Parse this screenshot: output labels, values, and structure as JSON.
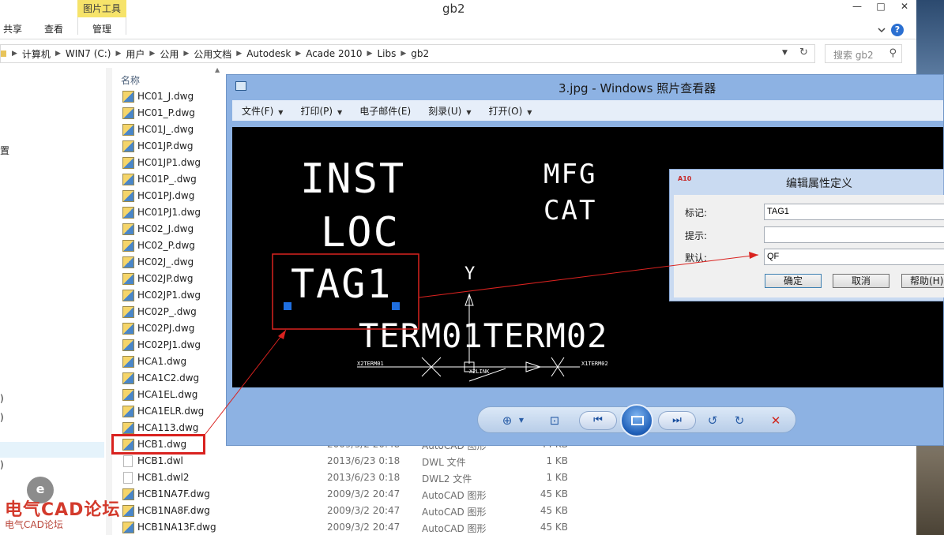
{
  "explorer": {
    "title": "gb2",
    "context_tab": "图片工具",
    "tabs": [
      "共享",
      "查看",
      "管理"
    ],
    "controls": {
      "minimize": "—",
      "maximize": "□",
      "close": "✕"
    },
    "help": "?",
    "address": [
      "计算机",
      "WIN7 (C:)",
      "用户",
      "公用",
      "公用文档",
      "Autodesk",
      "Acade 2010",
      "Libs",
      "gb2"
    ],
    "search_placeholder": "搜索 gb2",
    "nav_fragments": [
      "置",
      ")",
      ")",
      ")"
    ],
    "column_header": "名称",
    "files": [
      {
        "name": "HC01_J.dwg",
        "icon": "dwg-icon"
      },
      {
        "name": "HC01_P.dwg",
        "icon": "dwg-icon"
      },
      {
        "name": "HC01J_.dwg",
        "icon": "dwg-icon"
      },
      {
        "name": "HC01JP.dwg",
        "icon": "dwg-icon"
      },
      {
        "name": "HC01JP1.dwg",
        "icon": "dwg-icon"
      },
      {
        "name": "HC01P_.dwg",
        "icon": "dwg-icon"
      },
      {
        "name": "HC01PJ.dwg",
        "icon": "dwg-icon"
      },
      {
        "name": "HC01PJ1.dwg",
        "icon": "dwg-icon"
      },
      {
        "name": "HC02_J.dwg",
        "icon": "dwg-icon"
      },
      {
        "name": "HC02_P.dwg",
        "icon": "dwg-icon"
      },
      {
        "name": "HC02J_.dwg",
        "icon": "dwg-icon"
      },
      {
        "name": "HC02JP.dwg",
        "icon": "dwg-icon"
      },
      {
        "name": "HC02JP1.dwg",
        "icon": "dwg-icon"
      },
      {
        "name": "HC02P_.dwg",
        "icon": "dwg-icon"
      },
      {
        "name": "HC02PJ.dwg",
        "icon": "dwg-icon"
      },
      {
        "name": "HC02PJ1.dwg",
        "icon": "dwg-icon"
      },
      {
        "name": "HCA1.dwg",
        "icon": "dwg-icon"
      },
      {
        "name": "HCA1C2.dwg",
        "icon": "dwg-icon"
      },
      {
        "name": "HCA1EL.dwg",
        "icon": "dwg-icon"
      },
      {
        "name": "HCA1ELR.dwg",
        "icon": "dwg-icon"
      },
      {
        "name": "HCA113.dwg",
        "icon": "dwg-icon"
      },
      {
        "name": "HCB1.dwg",
        "date": "2009/3/2 20:48",
        "type": "AutoCAD 图形",
        "size": "44 KB",
        "icon": "dwg-icon"
      },
      {
        "name": "HCB1.dwl",
        "date": "2013/6/23 0:18",
        "type": "DWL 文件",
        "size": "1 KB",
        "icon": "file-icon"
      },
      {
        "name": "HCB1.dwl2",
        "date": "2013/6/23 0:18",
        "type": "DWL2 文件",
        "size": "1 KB",
        "icon": "file-icon"
      },
      {
        "name": "HCB1NA7F.dwg",
        "date": "2009/3/2 20:47",
        "type": "AutoCAD 图形",
        "size": "45 KB",
        "icon": "dwg-icon"
      },
      {
        "name": "HCB1NA8F.dwg",
        "date": "2009/3/2 20:47",
        "type": "AutoCAD 图形",
        "size": "45 KB",
        "icon": "dwg-icon"
      },
      {
        "name": "HCB1NA13F.dwg",
        "date": "2009/3/2 20:47",
        "type": "AutoCAD 图形",
        "size": "45 KB",
        "icon": "dwg-icon"
      }
    ]
  },
  "viewer": {
    "title": "3.jpg - Windows 照片查看器",
    "menus": [
      "文件(F)",
      "打印(P)",
      "电子邮件(E)",
      "刻录(U)",
      "打开(O)"
    ],
    "menus_with_dropdown": [
      true,
      true,
      false,
      true,
      true
    ],
    "cad": {
      "inst": "INST",
      "loc": "LOC",
      "mfg": "MFG",
      "cat": "CAT",
      "tag": "TAG1",
      "y": "Y",
      "term": "TERM01TERM02",
      "x2term01": "X2TERM01",
      "x1term02": "X1TERM02",
      "x2link": "X2LINK"
    }
  },
  "dialog": {
    "title": "编辑属性定义",
    "icon_text": "A10",
    "fields": [
      {
        "label": "标记:",
        "value": "TAG1"
      },
      {
        "label": "提示:",
        "value": ""
      },
      {
        "label": "默认:",
        "value": "QF"
      }
    ],
    "buttons": {
      "ok": "确定",
      "cancel": "取消",
      "help": "帮助(H)"
    }
  },
  "watermark": {
    "badge": "e",
    "text": "电气CAD论坛",
    "sub": "电气CAD论坛"
  },
  "colors": {
    "annotation_red": "#d9221f",
    "grip_blue": "#1f6fe0",
    "viewer_frame": "#8db2e3"
  }
}
